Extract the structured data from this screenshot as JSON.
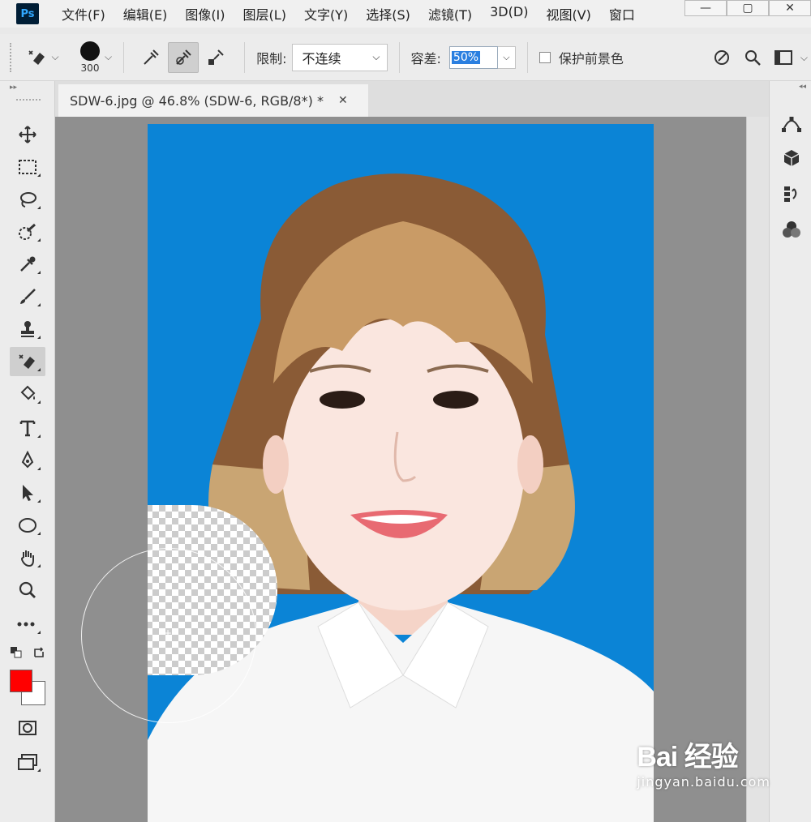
{
  "app": {
    "logo": "Ps"
  },
  "menu": [
    "文件(F)",
    "编辑(E)",
    "图像(I)",
    "图层(L)",
    "文字(Y)",
    "选择(S)",
    "滤镜(T)",
    "3D(D)",
    "视图(V)",
    "窗口"
  ],
  "window_controls": {
    "minimize": "—",
    "restore": "▢",
    "close": "✕"
  },
  "options": {
    "brush_size": "300",
    "limits_label": "限制:",
    "limits_value": "不连续",
    "tolerance_label": "容差:",
    "tolerance_value": "50%",
    "protect_foreground_label": "保护前景色",
    "protect_foreground_checked": false
  },
  "toolbar": {
    "collapse": "▸▸"
  },
  "document": {
    "tab_title": "SDW-6.jpg @ 46.8% (SDW-6, RGB/8*) *",
    "close": "✕"
  },
  "colors": {
    "foreground": "#ff0000",
    "background": "#ffffff",
    "photo_background": "#0b84d6"
  },
  "watermark": {
    "logo": "Bai 经验",
    "url": "jingyan.baidu.com"
  }
}
